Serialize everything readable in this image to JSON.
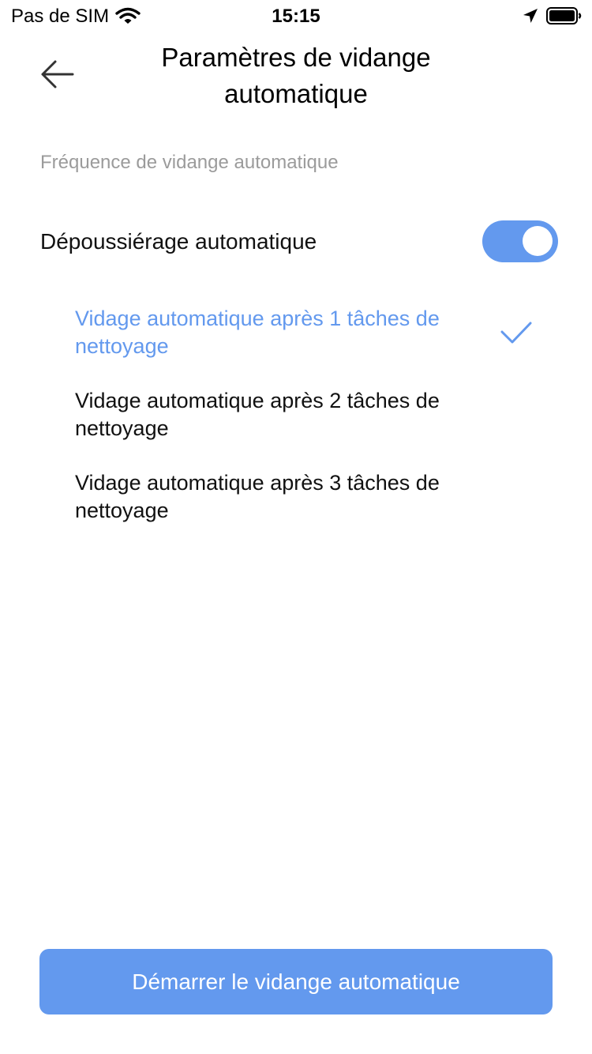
{
  "status_bar": {
    "carrier": "Pas de SIM",
    "time": "15:15",
    "icons": [
      "wifi-icon",
      "location-arrow-icon",
      "battery-icon"
    ]
  },
  "header": {
    "back_icon": "arrow-left-icon",
    "title": "Paramètres de vidange automatique"
  },
  "section": {
    "label": "Fréquence de vidange automatique"
  },
  "auto_dust": {
    "label": "Dépoussiérage automatique",
    "enabled": true
  },
  "options": [
    {
      "label": "Vidage automatique après 1 tâches de nettoyage",
      "selected": true
    },
    {
      "label": "Vidage automatique après 2 tâches de nettoyage",
      "selected": false
    },
    {
      "label": "Vidage automatique après 3 tâches de nettoyage",
      "selected": false
    }
  ],
  "start_button": {
    "label": "Démarrer le vidange automatique"
  },
  "colors": {
    "accent": "#6399ee",
    "muted_text": "#9b9b9b",
    "text": "#111111",
    "background": "#ffffff"
  }
}
